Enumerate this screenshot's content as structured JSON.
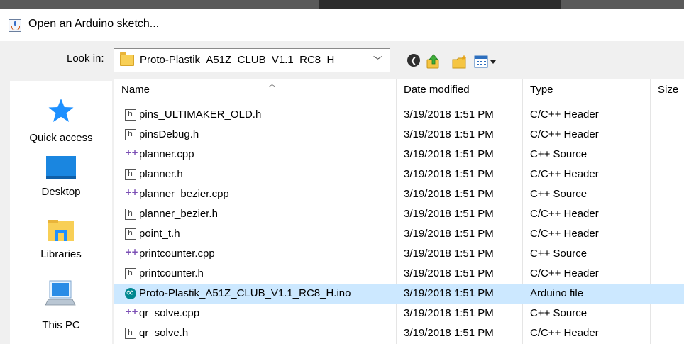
{
  "window": {
    "title": "Open an Arduino sketch..."
  },
  "toolbar": {
    "look_in_label": "Look in:",
    "look_in_value": "Proto-Plastik_A51Z_CLUB_V1.1_RC8_H",
    "buttons": [
      "back-icon",
      "up-folder-icon",
      "new-folder-icon",
      "views-menu-icon"
    ]
  },
  "sidebar": {
    "places": [
      {
        "label": "Quick access",
        "icon": "star-icon"
      },
      {
        "label": "Desktop",
        "icon": "desktop-icon"
      },
      {
        "label": "Libraries",
        "icon": "libraries-icon"
      },
      {
        "label": "This PC",
        "icon": "computer-icon"
      }
    ]
  },
  "file_list": {
    "columns": [
      "Name",
      "Date modified",
      "Type",
      "Size"
    ],
    "rows": [
      {
        "name": "pins_ULTIMAKER_OLD.h",
        "date": "3/19/2018 1:51 PM",
        "type": "C/C++ Header",
        "icon": "h-file-icon",
        "selected": false
      },
      {
        "name": "pinsDebug.h",
        "date": "3/19/2018 1:51 PM",
        "type": "C/C++ Header",
        "icon": "h-file-icon",
        "selected": false
      },
      {
        "name": "planner.cpp",
        "date": "3/19/2018 1:51 PM",
        "type": "C++ Source",
        "icon": "cpp-file-icon",
        "selected": false
      },
      {
        "name": "planner.h",
        "date": "3/19/2018 1:51 PM",
        "type": "C/C++ Header",
        "icon": "h-file-icon",
        "selected": false
      },
      {
        "name": "planner_bezier.cpp",
        "date": "3/19/2018 1:51 PM",
        "type": "C++ Source",
        "icon": "cpp-file-icon",
        "selected": false
      },
      {
        "name": "planner_bezier.h",
        "date": "3/19/2018 1:51 PM",
        "type": "C/C++ Header",
        "icon": "h-file-icon",
        "selected": false
      },
      {
        "name": "point_t.h",
        "date": "3/19/2018 1:51 PM",
        "type": "C/C++ Header",
        "icon": "h-file-icon",
        "selected": false
      },
      {
        "name": "printcounter.cpp",
        "date": "3/19/2018 1:51 PM",
        "type": "C++ Source",
        "icon": "cpp-file-icon",
        "selected": false
      },
      {
        "name": "printcounter.h",
        "date": "3/19/2018 1:51 PM",
        "type": "C/C++ Header",
        "icon": "h-file-icon",
        "selected": false
      },
      {
        "name": "Proto-Plastik_A51Z_CLUB_V1.1_RC8_H.ino",
        "date": "3/19/2018 1:51 PM",
        "type": "Arduino file",
        "icon": "arduino-file-icon",
        "selected": true
      },
      {
        "name": "qr_solve.cpp",
        "date": "3/19/2018 1:51 PM",
        "type": "C++ Source",
        "icon": "cpp-file-icon",
        "selected": false
      },
      {
        "name": "qr_solve.h",
        "date": "3/19/2018 1:51 PM",
        "type": "C/C++ Header",
        "icon": "h-file-icon",
        "selected": false
      }
    ]
  },
  "colors": {
    "selection": "#cce8ff",
    "toolbar_bg": "#f0f0f0",
    "accent_blue": "#1e90ff"
  }
}
